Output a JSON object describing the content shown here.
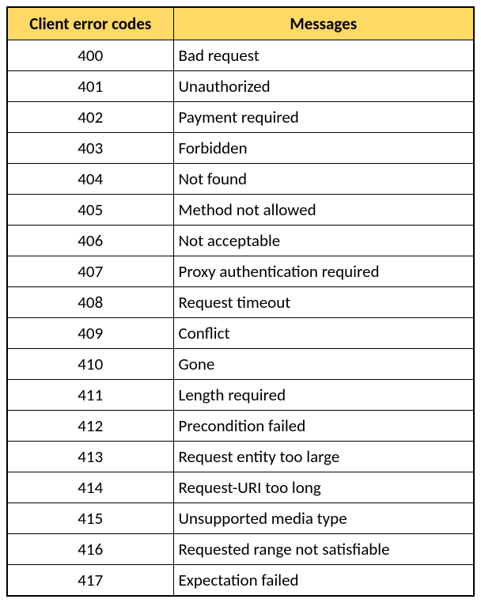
{
  "headers": {
    "codes": "Client error codes",
    "messages": "Messages"
  },
  "chart_data": {
    "type": "table",
    "columns": [
      "Client error codes",
      "Messages"
    ],
    "rows": [
      {
        "code": "400",
        "message": "Bad request"
      },
      {
        "code": "401",
        "message": "Unauthorized"
      },
      {
        "code": "402",
        "message": "Payment required"
      },
      {
        "code": "403",
        "message": "Forbidden"
      },
      {
        "code": "404",
        "message": "Not found"
      },
      {
        "code": "405",
        "message": "Method not allowed"
      },
      {
        "code": "406",
        "message": "Not acceptable"
      },
      {
        "code": "407",
        "message": "Proxy authentication required"
      },
      {
        "code": "408",
        "message": "Request timeout"
      },
      {
        "code": "409",
        "message": "Conflict"
      },
      {
        "code": "410",
        "message": "Gone"
      },
      {
        "code": "411",
        "message": "Length required"
      },
      {
        "code": "412",
        "message": "Precondition failed"
      },
      {
        "code": "413",
        "message": "Request entity too large"
      },
      {
        "code": "414",
        "message": "Request-URI too long"
      },
      {
        "code": "415",
        "message": "Unsupported media type"
      },
      {
        "code": "416",
        "message": "Requested range not satisfiable"
      },
      {
        "code": "417",
        "message": "Expectation failed"
      }
    ]
  }
}
